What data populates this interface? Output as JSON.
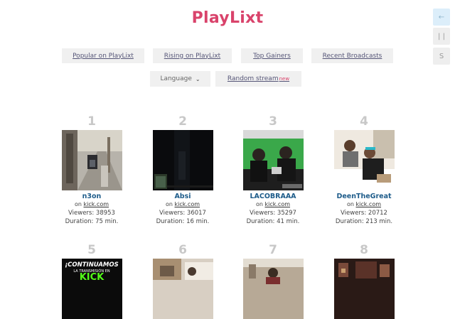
{
  "app": {
    "title": "PlayLixt"
  },
  "side": [
    {
      "label": "←",
      "icon": "arrow-left-icon"
    },
    {
      "label": "| |",
      "icon": "pause-icon"
    },
    {
      "label": "S",
      "icon": "s-letter-icon"
    }
  ],
  "nav": [
    {
      "label": "Popular on PlayLixt"
    },
    {
      "label": "Rising on PlayLixt"
    },
    {
      "label": "Top Gainers"
    },
    {
      "label": "Recent Broadcasts"
    }
  ],
  "filters": {
    "language_label": "Language",
    "random_label": "Random stream",
    "new_badge": "new"
  },
  "streams": [
    {
      "rank": "1",
      "name": "n3on",
      "on": "on",
      "platform": "kick.com",
      "viewers": "Viewers: 38953",
      "duration": "Duration: 75 min."
    },
    {
      "rank": "2",
      "name": "Absi",
      "on": "on",
      "platform": "kick.com",
      "viewers": "Viewers: 36017",
      "duration": "Duration: 16 min."
    },
    {
      "rank": "3",
      "name": "LACOBRAAA",
      "on": "on",
      "platform": "kick.com",
      "viewers": "Viewers: 35297",
      "duration": "Duration: 41 min."
    },
    {
      "rank": "4",
      "name": "DeenTheGreat",
      "on": "on",
      "platform": "kick.com",
      "viewers": "Viewers: 20712",
      "duration": "Duration: 213 min."
    },
    {
      "rank": "5",
      "thumb_text_1": "¡CONTINUAMOS",
      "thumb_text_2": "LA TRANSMISIÓN EN",
      "thumb_text_3": "KICK"
    },
    {
      "rank": "6"
    },
    {
      "rank": "7"
    },
    {
      "rank": "8"
    }
  ]
}
